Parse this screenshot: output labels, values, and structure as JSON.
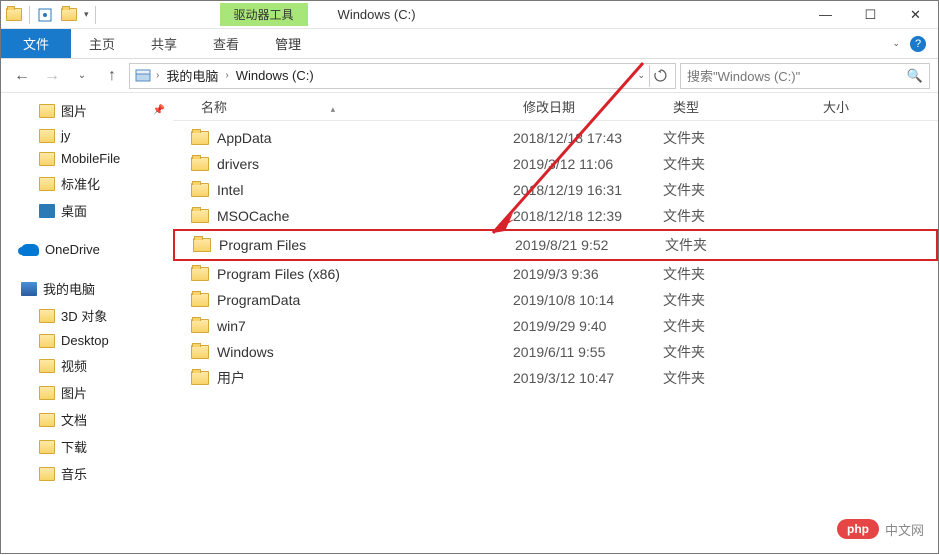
{
  "title": {
    "context_tab": "驱动器工具",
    "window_title": "Windows (C:)"
  },
  "ribbon": {
    "file": "文件",
    "home": "主页",
    "share": "共享",
    "view": "查看",
    "manage": "管理"
  },
  "address": {
    "seg1": "我的电脑",
    "seg2": "Windows (C:)"
  },
  "search": {
    "placeholder": "搜索\"Windows (C:)\""
  },
  "sidebar": {
    "items": [
      {
        "label": "图片",
        "icon": "folder",
        "pinned": true
      },
      {
        "label": "jy",
        "icon": "folder"
      },
      {
        "label": "MobileFile",
        "icon": "folder"
      },
      {
        "label": "标准化",
        "icon": "folder"
      },
      {
        "label": "桌面",
        "icon": "desktop"
      },
      {
        "label": "OneDrive",
        "icon": "onedrive",
        "top": true
      },
      {
        "label": "我的电脑",
        "icon": "pc",
        "top": true
      },
      {
        "label": "3D 对象",
        "icon": "folder"
      },
      {
        "label": "Desktop",
        "icon": "folder"
      },
      {
        "label": "视频",
        "icon": "folder"
      },
      {
        "label": "图片",
        "icon": "folder"
      },
      {
        "label": "文档",
        "icon": "folder"
      },
      {
        "label": "下载",
        "icon": "folder"
      },
      {
        "label": "音乐",
        "icon": "folder"
      }
    ]
  },
  "columns": {
    "name": "名称",
    "date": "修改日期",
    "type": "类型",
    "size": "大小"
  },
  "files": [
    {
      "name": "AppData",
      "date": "2018/12/18 17:43",
      "type": "文件夹"
    },
    {
      "name": "drivers",
      "date": "2019/3/12 11:06",
      "type": "文件夹"
    },
    {
      "name": "Intel",
      "date": "2018/12/19 16:31",
      "type": "文件夹"
    },
    {
      "name": "MSOCache",
      "date": "2018/12/18 12:39",
      "type": "文件夹"
    },
    {
      "name": "Program Files",
      "date": "2019/8/21 9:52",
      "type": "文件夹",
      "highlighted": true
    },
    {
      "name": "Program Files (x86)",
      "date": "2019/9/3 9:36",
      "type": "文件夹"
    },
    {
      "name": "ProgramData",
      "date": "2019/10/8 10:14",
      "type": "文件夹"
    },
    {
      "name": "win7",
      "date": "2019/9/29 9:40",
      "type": "文件夹"
    },
    {
      "name": "Windows",
      "date": "2019/6/11 9:55",
      "type": "文件夹"
    },
    {
      "name": "用户",
      "date": "2019/3/12 10:47",
      "type": "文件夹"
    }
  ],
  "watermark": {
    "badge": "php",
    "text": "中文网"
  }
}
